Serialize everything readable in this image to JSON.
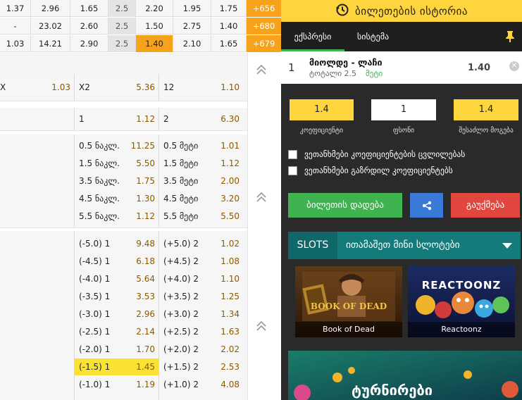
{
  "top_rows": [
    [
      "1.37",
      "2.96",
      "1.65",
      "2.5",
      "2.20",
      "1.95",
      "1.75",
      "+656"
    ],
    [
      "-",
      "23.02",
      "2.60",
      "2.5",
      "1.50",
      "2.75",
      "1.40",
      "+680"
    ],
    [
      "1.03",
      "14.21",
      "2.90",
      "2.5",
      "1.40",
      "2.10",
      "1.65",
      "+679"
    ]
  ],
  "double_chance": {
    "row1": [
      {
        "label": "X",
        "odd": "1.03"
      },
      {
        "label": "X2",
        "odd": "5.36"
      },
      {
        "label": "12",
        "odd": "1.10"
      }
    ],
    "row2": [
      {
        "label": "1",
        "odd": "1.12"
      },
      {
        "label": "2",
        "odd": "6.30"
      }
    ]
  },
  "totals": [
    {
      "under_label": "0.5 ნაკლ.",
      "under_odd": "11.25",
      "over_label": "0.5 მეტი",
      "over_odd": "1.01"
    },
    {
      "under_label": "1.5 ნაკლ.",
      "under_odd": "5.50",
      "over_label": "1.5 მეტი",
      "over_odd": "1.12"
    },
    {
      "under_label": "3.5 ნაკლ.",
      "under_odd": "1.75",
      "over_label": "3.5 მეტი",
      "over_odd": "2.00"
    },
    {
      "under_label": "4.5 ნაკლ.",
      "under_odd": "1.30",
      "over_label": "4.5 მეტი",
      "over_odd": "3.20"
    },
    {
      "under_label": "5.5 ნაკლ.",
      "under_odd": "1.12",
      "over_label": "5.5 მეტი",
      "over_odd": "5.50"
    }
  ],
  "handicaps": [
    {
      "h1_label": "(-5.0) 1",
      "h1_odd": "9.48",
      "h2_label": "(+5.0) 2",
      "h2_odd": "1.02"
    },
    {
      "h1_label": "(-4.5) 1",
      "h1_odd": "6.18",
      "h2_label": "(+4.5) 2",
      "h2_odd": "1.08"
    },
    {
      "h1_label": "(-4.0) 1",
      "h1_odd": "5.64",
      "h2_label": "(+4.0) 2",
      "h2_odd": "1.10"
    },
    {
      "h1_label": "(-3.5) 1",
      "h1_odd": "3.53",
      "h2_label": "(+3.5) 2",
      "h2_odd": "1.25"
    },
    {
      "h1_label": "(-3.0) 1",
      "h1_odd": "2.96",
      "h2_label": "(+3.0) 2",
      "h2_odd": "1.34"
    },
    {
      "h1_label": "(-2.5) 1",
      "h1_odd": "2.14",
      "h2_label": "(+2.5) 2",
      "h2_odd": "1.63"
    },
    {
      "h1_label": "(-2.0) 1",
      "h1_odd": "1.70",
      "h2_label": "(+2.0) 2",
      "h2_odd": "2.02"
    },
    {
      "h1_label": "(-1.5) 1",
      "h1_odd": "1.45",
      "h2_label": "(+1.5) 2",
      "h2_odd": "2.53"
    },
    {
      "h1_label": "(-1.0) 1",
      "h1_odd": "1.19",
      "h2_label": "(+1.0) 2",
      "h2_odd": "4.08"
    }
  ],
  "right": {
    "header_title": "ბილეთების ისტორია",
    "tabs": [
      "ექსპრესი",
      "სისტემა"
    ],
    "bet": {
      "index": "1",
      "match": "მიოლდე - ლაჩი",
      "market": "ტოტალი 2.5",
      "pick": "მეტი",
      "odds": "1.40"
    },
    "coef_value": "1.4",
    "stake_value": "1",
    "win_value": "1.4",
    "coef_caption": "კოეფიციენტი",
    "stake_caption": "ფსონი",
    "win_caption": "შესაძლო მოგება",
    "check1": "ვეთანხმები კოეფიციენტების ცვლილებას",
    "check2": "ვეთანხმები გაზრდილ კოეფიციენტებს",
    "place_bet": "ბილეთის დადება",
    "cancel": "გაუქმება",
    "slots_tag": "SLOTS",
    "slots_text": "ითამაშეთ მინი სლოტები",
    "game1": "Book of Dead",
    "game2": "Reactoonz",
    "game2_logo": "REACTOONZ",
    "game1_logo": "BOOK OF DEAD",
    "promo_text": "ტურნირები"
  },
  "colors": {
    "accent_yellow": "#ffd53d",
    "orange": "#f7a21b",
    "green": "#3fb34f",
    "blue": "#3a79d6",
    "red": "#e2473f",
    "teal": "#147b7a"
  }
}
